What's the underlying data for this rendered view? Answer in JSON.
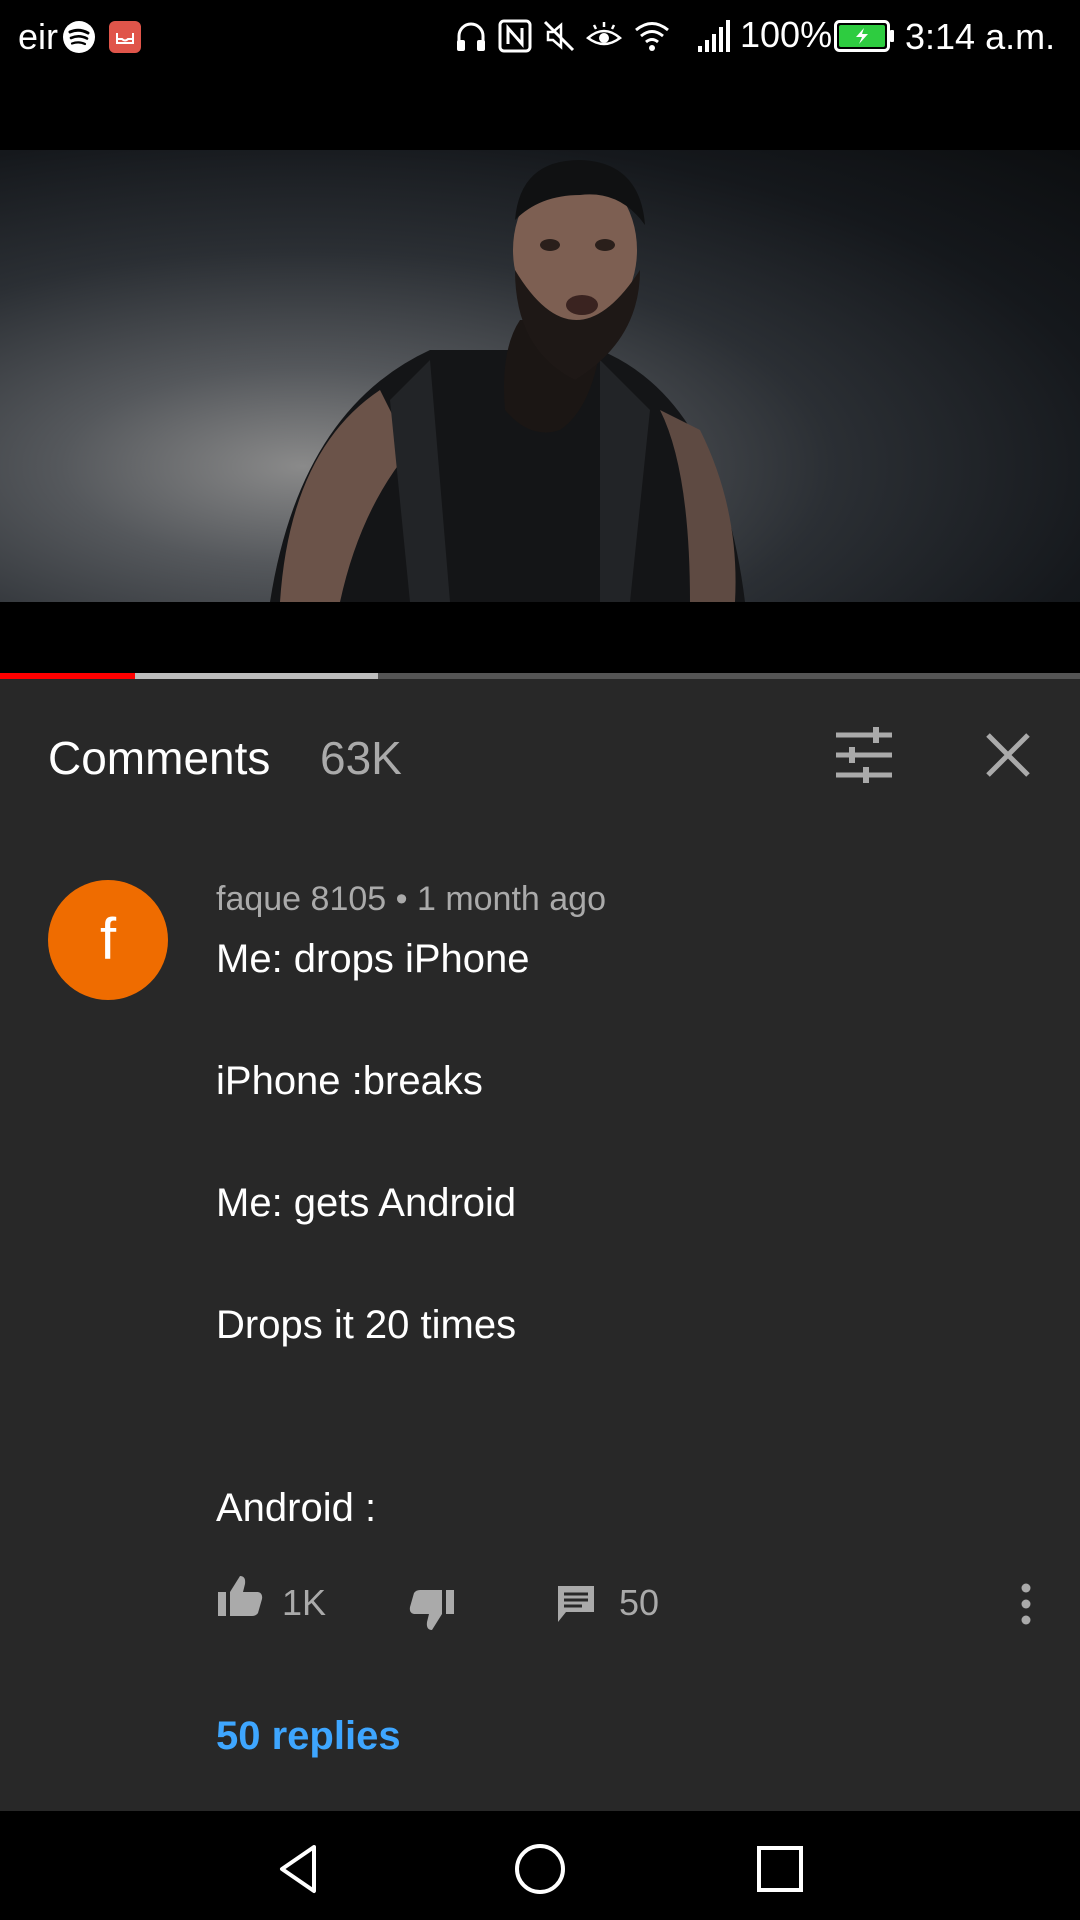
{
  "status_bar": {
    "carrier": "eir",
    "battery_percent": "100%",
    "time": "3:14 a.m.",
    "icons": [
      "spotify-icon",
      "inbox-app-icon",
      "headphones-icon",
      "nfc-icon",
      "mute-icon",
      "eye-comfort-icon",
      "wifi-icon",
      "signal-icon",
      "battery-charging-icon"
    ]
  },
  "video": {
    "progress_played_fraction": 0.125,
    "progress_buffered_fraction": 0.35,
    "played_color": "#ff0000"
  },
  "comments": {
    "title": "Comments",
    "count": "63K",
    "filter_icon": "sort-filter-icon",
    "close_icon": "close-icon"
  },
  "comment": {
    "avatar_letter": "f",
    "avatar_color": "#ef6c00",
    "meta": "faque 8105 • 1 month ago",
    "lines": [
      "Me: drops iPhone",
      "iPhone :breaks",
      "Me: gets Android",
      "Drops it 20 times",
      "Android :"
    ],
    "likes": "1K",
    "reply_count": "50",
    "replies_link": "50 replies",
    "link_color": "#3ea6ff"
  },
  "nav_bar": {
    "icons": [
      "back-icon",
      "home-icon",
      "recents-icon"
    ]
  }
}
